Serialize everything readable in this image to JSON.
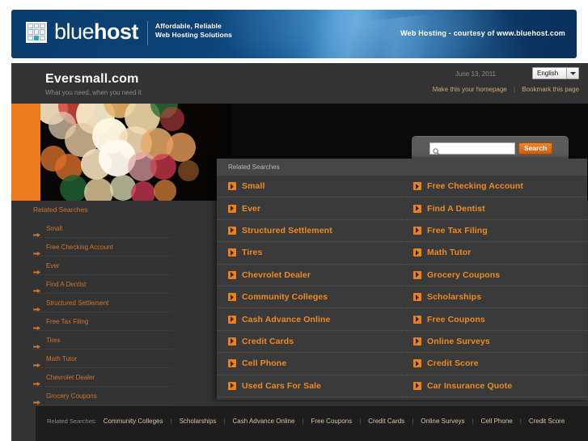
{
  "banner": {
    "logo_text_light": "blue",
    "logo_text_bold": "host",
    "tagline_line1": "Affordable, Reliable",
    "tagline_line2": "Web Hosting Solutions",
    "right_text": "Web Hosting - courtesy of www.bluehost.com",
    "brand_color": "#0b3c6e",
    "logo_accent_color": "#2fa8b4"
  },
  "header": {
    "site_title": "Eversmall.com",
    "site_tagline": "What you need, when you need it",
    "date": "June 13, 2011",
    "language_selected": "English",
    "link_homepage": "Make this your homepage",
    "link_bookmark": "Bookmark this page"
  },
  "search": {
    "value": "",
    "placeholder": "",
    "button_label": "Search",
    "button_color": "#cf5f11"
  },
  "sidebar": {
    "title": "Related Searches",
    "accent_color": "#d1762a",
    "items": [
      {
        "label": "Small"
      },
      {
        "label": "Free Checking Account"
      },
      {
        "label": "Ever"
      },
      {
        "label": "Find A Dentist"
      },
      {
        "label": "Structured Settlement"
      },
      {
        "label": "Free Tax Filing"
      },
      {
        "label": "Tires"
      },
      {
        "label": "Math Tutor"
      },
      {
        "label": "Chevrolet Dealer"
      },
      {
        "label": "Grocery Coupons"
      }
    ]
  },
  "related_panel": {
    "title": "Related Searches",
    "accent_color": "#ef8a22",
    "items": [
      {
        "label": "Small"
      },
      {
        "label": "Free Checking Account"
      },
      {
        "label": "Ever"
      },
      {
        "label": "Find A Dentist"
      },
      {
        "label": "Structured Settlement"
      },
      {
        "label": "Free Tax Filing"
      },
      {
        "label": "Tires"
      },
      {
        "label": "Math Tutor"
      },
      {
        "label": "Chevrolet Dealer"
      },
      {
        "label": "Grocery Coupons"
      },
      {
        "label": "Community Colleges"
      },
      {
        "label": "Scholarships"
      },
      {
        "label": "Cash Advance Online"
      },
      {
        "label": "Free Coupons"
      },
      {
        "label": "Credit Cards"
      },
      {
        "label": "Online Surveys"
      },
      {
        "label": "Cell Phone"
      },
      {
        "label": "Credit Score"
      },
      {
        "label": "Used Cars For Sale"
      },
      {
        "label": "Car Insurance Quote"
      }
    ]
  },
  "footer": {
    "label": "Related Searches:",
    "links": [
      "Community Colleges",
      "Scholarships",
      "Cash Advance Online",
      "Free Coupons",
      "Credit Cards",
      "Online Surveys",
      "Cell Phone",
      "Credit Score"
    ]
  }
}
